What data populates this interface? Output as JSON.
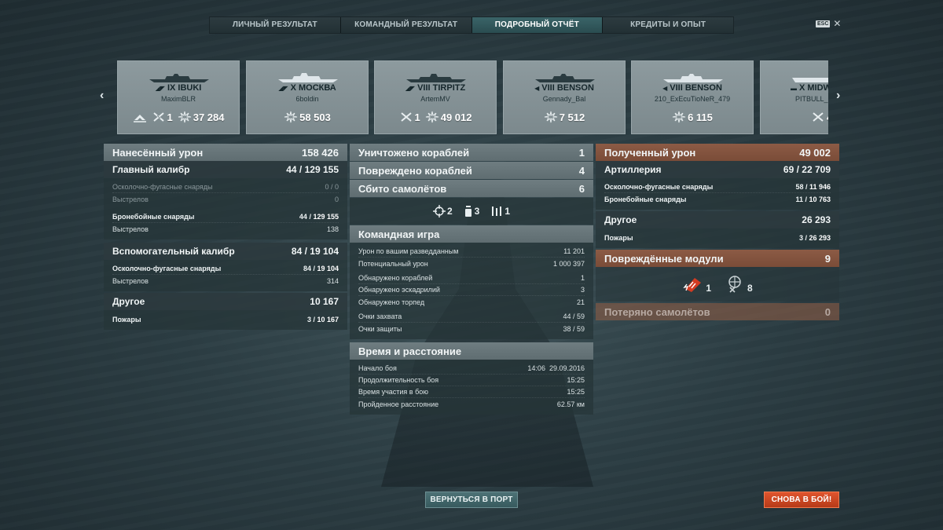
{
  "tabs": [
    {
      "label": "ЛИЧНЫЙ РЕЗУЛЬТАТ",
      "active": false
    },
    {
      "label": "КОМАНДНЫЙ РЕЗУЛЬТАТ",
      "active": false
    },
    {
      "label": "ПОДРОБНЫЙ ОТЧЁТ",
      "active": true
    },
    {
      "label": "КРЕДИТЫ И ОПЫТ",
      "active": false
    }
  ],
  "esc": {
    "key": "ESC",
    "close": "✕"
  },
  "carousel": {
    "prev": "‹",
    "next": "›"
  },
  "cards": [
    {
      "ship": "IX IBUKI",
      "player": "MaximBLR",
      "planes": "1",
      "damage": "37 284",
      "torpedo_icon": true
    },
    {
      "ship": "X МОСКВА",
      "player": "6boldin",
      "planes": "",
      "damage": "58 503",
      "torpedo_icon": false
    },
    {
      "ship": "VIII TIRPITZ",
      "player": "ArtemMV",
      "planes": "1",
      "damage": "49 012",
      "torpedo_icon": false
    },
    {
      "ship": "VIII BENSON",
      "player": "Gennady_Bal",
      "planes": "",
      "damage": "7 512",
      "torpedo_icon": false
    },
    {
      "ship": "VIII BENSON",
      "player": "210_ExEcuTioNeR_479",
      "planes": "",
      "damage": "6 115",
      "torpedo_icon": false
    },
    {
      "ship": "X MIDW",
      "player": "PITBULL_",
      "planes": "4",
      "damage": "",
      "torpedo_icon": false
    }
  ],
  "left": {
    "dealt": {
      "label": "Нанесённый урон",
      "value": "158 426"
    },
    "main_caliber": {
      "label": "Главный калибр",
      "hits": "44",
      "total": "129 155"
    },
    "mc_he": {
      "label": "Осколочно-фугасные снаряды",
      "hits": "0",
      "total": "0"
    },
    "mc_he_shots": {
      "label": "Выстрелов",
      "value": "0"
    },
    "mc_ap": {
      "label": "Бронебойные снаряды",
      "hits": "44",
      "total": "129 155"
    },
    "mc_ap_shots": {
      "label": "Выстрелов",
      "value": "138"
    },
    "secondary": {
      "label": "Вспомогательный калибр",
      "hits": "84",
      "total": "19 104"
    },
    "sec_he": {
      "label": "Осколочно-фугасные снаряды",
      "hits": "84",
      "total": "19 104"
    },
    "sec_shots": {
      "label": "Выстрелов",
      "value": "314"
    },
    "other": {
      "label": "Другое",
      "value": "10 167"
    },
    "fires": {
      "label": "Пожары",
      "hits": "3",
      "total": "10 167"
    }
  },
  "mid": {
    "destroyed": {
      "label": "Уничтожено кораблей",
      "value": "1"
    },
    "damaged": {
      "label": "Повреждено кораблей",
      "value": "4"
    },
    "planes": {
      "label": "Сбито самолётов",
      "value": "6"
    },
    "plane_icons": [
      {
        "icon": "crosshair-icon",
        "value": "2"
      },
      {
        "icon": "bomb-icon",
        "value": "3"
      },
      {
        "icon": "torpedo-bombers-icon",
        "value": "1"
      }
    ],
    "team": {
      "label": "Командная игра"
    },
    "team_rows": [
      {
        "label": "Урон по вашим разведданным",
        "value": "11 201"
      },
      {
        "label": "Потенциальный урон",
        "value": "1 000 397"
      },
      {
        "label": "Обнаружено кораблей",
        "value": "1"
      },
      {
        "label": "Обнаружено эскадрилий",
        "value": "3"
      },
      {
        "label": "Обнаружено торпед",
        "value": "21"
      },
      {
        "label": "Очки захвата",
        "value": "44 / 59"
      },
      {
        "label": "Очки защиты",
        "value": "38 / 59"
      }
    ],
    "time": {
      "label": "Время и расстояние"
    },
    "time_rows": [
      {
        "label": "Начало боя",
        "value": "14:06  29.09.2016"
      },
      {
        "label": "Продолжительность боя",
        "value": "15:25"
      },
      {
        "label": "Время участия в бою",
        "value": "15:25"
      },
      {
        "label": "Пройденное расстояние",
        "value": "62.57 км"
      }
    ]
  },
  "right": {
    "received": {
      "label": "Полученный урон",
      "value": "49 002"
    },
    "artillery": {
      "label": "Артиллерия",
      "hits": "69",
      "total": "22 709"
    },
    "art_he": {
      "label": "Осколочно-фугасные снаряды",
      "hits": "58",
      "total": "11 946"
    },
    "art_ap": {
      "label": "Бронебойные снаряды",
      "hits": "11",
      "total": "10 763"
    },
    "other": {
      "label": "Другое",
      "value": "26 293"
    },
    "fires": {
      "label": "Пожары",
      "hits": "3",
      "total": "26 293"
    },
    "modules": {
      "label": "Повреждённые модули",
      "value": "9"
    },
    "module_icons": [
      {
        "icon": "engine-damage-icon",
        "value": "1"
      },
      {
        "icon": "steering-damage-icon",
        "value": "8"
      }
    ],
    "planes_lost": {
      "label": "Потеряно самолётов",
      "value": "0"
    }
  },
  "buttons": {
    "port": "ВЕРНУТЬСЯ В ПОРТ",
    "battle": "СНОВА В БОЙ!"
  }
}
